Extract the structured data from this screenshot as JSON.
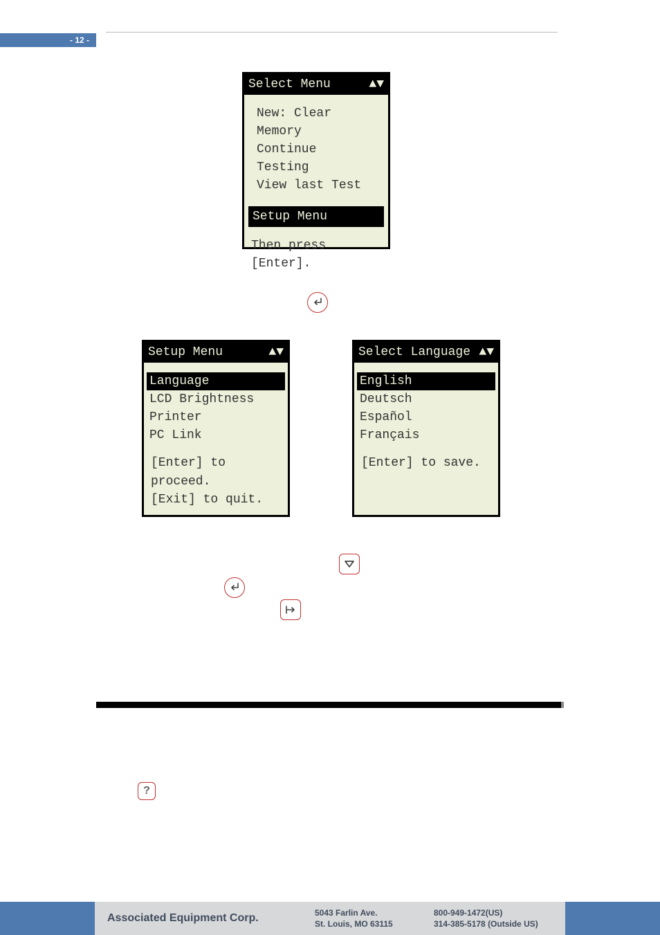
{
  "page_number": "- 12 -",
  "lcd1": {
    "title": "Select Menu",
    "arrows": "▲▼",
    "items": [
      "New: Clear Memory",
      "Continue Testing",
      "View last Test"
    ],
    "selected": "Setup Menu",
    "hint": "Then press [Enter]."
  },
  "lcd2": {
    "title": "Setup Menu",
    "arrows": "▲▼",
    "selected": "Language",
    "items": [
      "LCD Brightness",
      "Printer",
      "PC Link"
    ],
    "hint1": "[Enter] to proceed.",
    "hint2": "[Exit] to quit."
  },
  "lcd3": {
    "title": "Select Language",
    "arrows": "▲▼",
    "selected": "English",
    "items": [
      "Deutsch",
      "Español",
      "Français"
    ],
    "hint": "[Enter] to save."
  },
  "help_icon": "?",
  "footer": {
    "company": "Associated Equipment Corp.",
    "addr1": "5043 Farlin Ave.",
    "addr2": "St. Louis, MO 63115",
    "ph1": "800-949-1472(US)",
    "ph2": "314-385-5178 (Outside US)"
  }
}
